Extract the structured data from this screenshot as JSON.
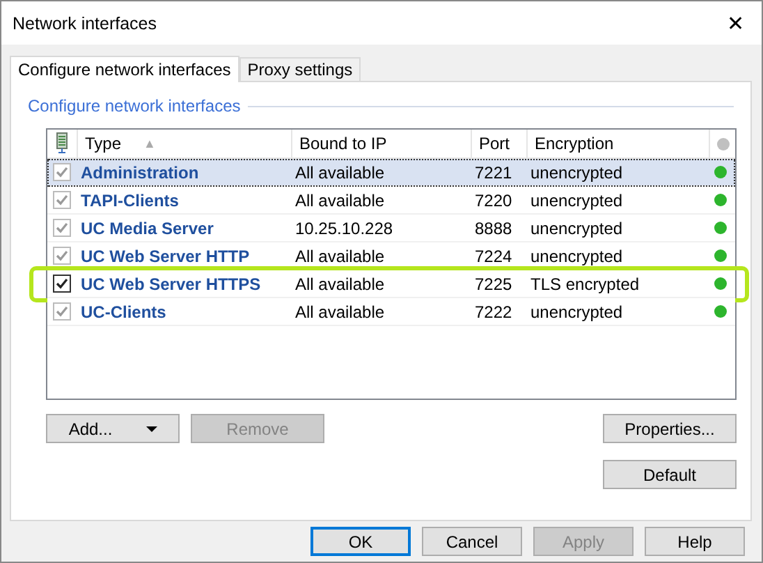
{
  "window": {
    "title": "Network interfaces",
    "close": "✕"
  },
  "tabs": [
    {
      "label": "Configure network interfaces",
      "selected": true
    },
    {
      "label": "Proxy settings",
      "selected": false
    }
  ],
  "group": {
    "title": "Configure network interfaces"
  },
  "table": {
    "columns": [
      "Type",
      "Bound to IP",
      "Port",
      "Encryption"
    ],
    "sort_arrow": "▲",
    "rows": [
      {
        "type": "Administration",
        "bound": "All available",
        "port": "7221",
        "encryption": "unencrypted",
        "checked": true,
        "disabled": true,
        "selected": true,
        "highlighted": false,
        "color": "#2db52d"
      },
      {
        "type": "TAPI-Clients",
        "bound": "All available",
        "port": "7220",
        "encryption": "unencrypted",
        "checked": true,
        "disabled": true,
        "selected": false,
        "highlighted": false,
        "color": "#2db52d"
      },
      {
        "type": "UC Media Server",
        "bound": "10.25.10.228",
        "port": "8888",
        "encryption": "unencrypted",
        "checked": true,
        "disabled": true,
        "selected": false,
        "highlighted": false,
        "color": "#2db52d"
      },
      {
        "type": "UC Web Server HTTP",
        "bound": "All available",
        "port": "7224",
        "encryption": "unencrypted",
        "checked": true,
        "disabled": true,
        "selected": false,
        "highlighted": false,
        "color": "#2db52d"
      },
      {
        "type": "UC Web Server HTTPS",
        "bound": "All available",
        "port": "7225",
        "encryption": "TLS encrypted",
        "checked": true,
        "disabled": false,
        "selected": false,
        "highlighted": true,
        "color": "#2db52d"
      },
      {
        "type": "UC-Clients",
        "bound": "All available",
        "port": "7222",
        "encryption": "unencrypted",
        "checked": true,
        "disabled": true,
        "selected": false,
        "highlighted": false,
        "color": "#2db52d"
      }
    ]
  },
  "panel_buttons": [
    {
      "label": "Add...",
      "disabled": false,
      "dropdown": true
    },
    {
      "label": "Remove",
      "disabled": true,
      "dropdown": false
    },
    {
      "label": "Properties...",
      "disabled": false,
      "dropdown": false
    }
  ],
  "default_button": {
    "label": "Default",
    "disabled": false
  },
  "footer_buttons": [
    {
      "label": "OK",
      "disabled": false,
      "default": true
    },
    {
      "label": "Cancel",
      "disabled": false,
      "default": false
    },
    {
      "label": "Apply",
      "disabled": true,
      "default": false
    },
    {
      "label": "Help",
      "disabled": false,
      "default": false
    }
  ]
}
